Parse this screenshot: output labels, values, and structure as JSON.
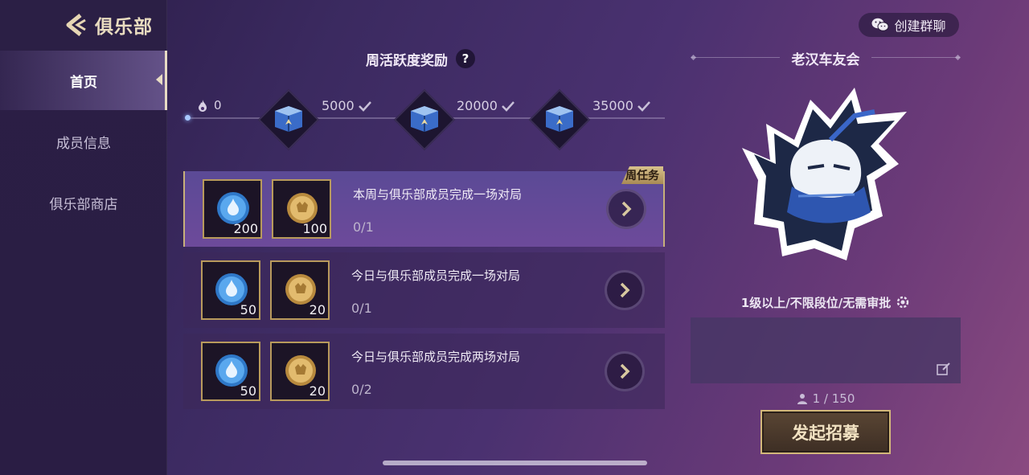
{
  "header": {
    "back_title": "俱乐部",
    "wechat_label": "创建群聊"
  },
  "sidebar": {
    "items": [
      {
        "label": "首页",
        "active": true
      },
      {
        "label": "成员信息",
        "active": false
      },
      {
        "label": "俱乐部商店",
        "active": false
      }
    ]
  },
  "weekly": {
    "title": "周活跃度奖励",
    "help": "?",
    "start_value": "0",
    "milestones": [
      {
        "value": "5000",
        "claimed": true
      },
      {
        "value": "20000",
        "claimed": true
      },
      {
        "value": "35000",
        "claimed": true
      }
    ]
  },
  "tasks": [
    {
      "tag": "周任务",
      "desc": "本周与俱乐部成员完成一场对局",
      "progress": "0/1",
      "rewards": [
        {
          "icon": "activity-droplet",
          "amount": "200"
        },
        {
          "icon": "club-coin",
          "amount": "100"
        }
      ]
    },
    {
      "tag": "",
      "desc": "今日与俱乐部成员完成一场对局",
      "progress": "0/1",
      "rewards": [
        {
          "icon": "activity-droplet",
          "amount": "50"
        },
        {
          "icon": "club-coin",
          "amount": "20"
        }
      ]
    },
    {
      "tag": "",
      "desc": "今日与俱乐部成员完成两场对局",
      "progress": "0/2",
      "rewards": [
        {
          "icon": "activity-droplet",
          "amount": "50"
        },
        {
          "icon": "club-coin",
          "amount": "20"
        }
      ]
    }
  ],
  "club": {
    "name": "老汉车友会",
    "requirements": "1级以上/不限段位/无需审批",
    "member_count": "1 / 150",
    "recruit_label": "发起招募"
  },
  "colors": {
    "accent_gold": "#c8b07a",
    "highlight_row": "#5b4a96",
    "droplet_blue": "#3a8fe0",
    "coin_gold": "#d6ad5e"
  }
}
